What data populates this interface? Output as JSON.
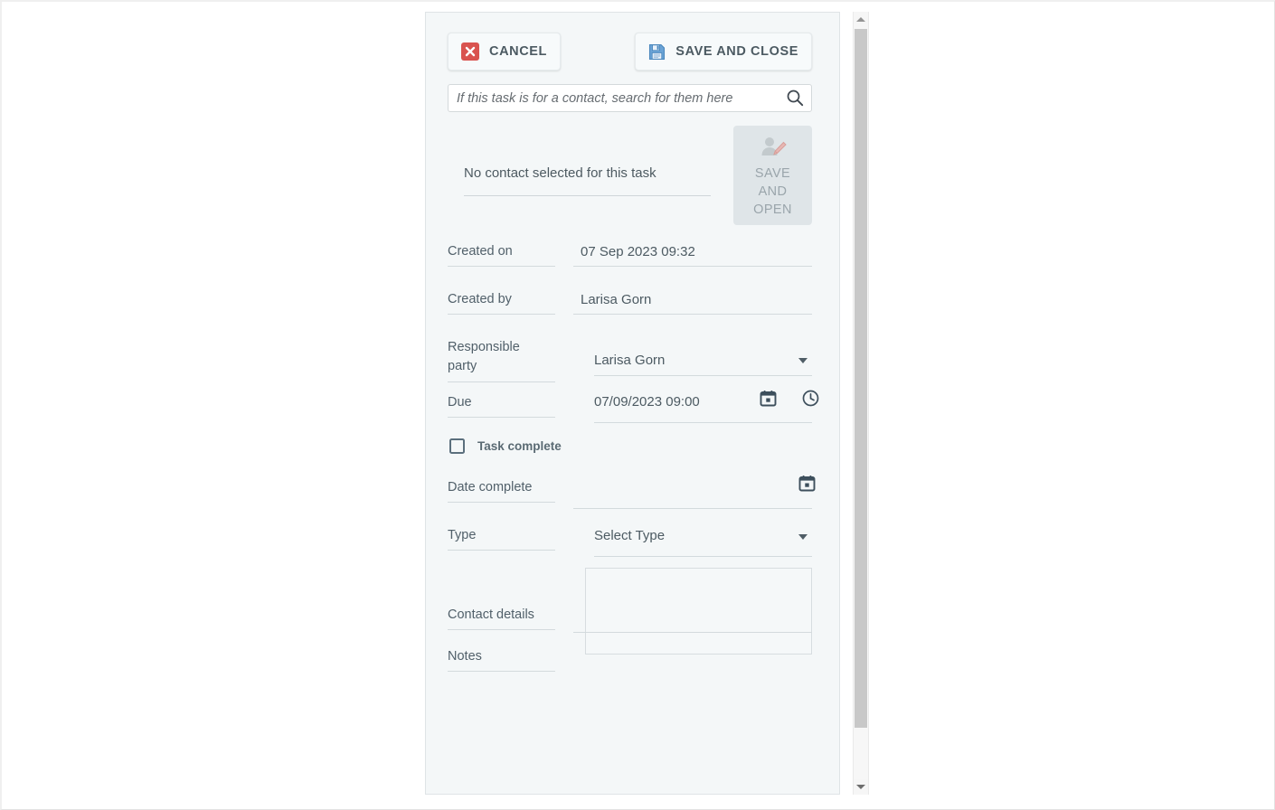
{
  "panel": {
    "toolbar": {
      "cancel_label": "CANCEL",
      "cancel_icon": "close-x-icon",
      "save_close_label": "SAVE AND CLOSE",
      "save_close_icon": "floppy-disk-save-icon"
    },
    "contact_search": {
      "value": "",
      "placeholder": "If this task is for a contact, search for them here",
      "icon": "search-icon"
    },
    "contact": {
      "status_text": "No contact selected for this task",
      "save_open_label_line1": "SAVE",
      "save_open_label_line2": "AND",
      "save_open_label_line3": "OPEN",
      "save_open_icon": "contact-edit-icon",
      "save_open_disabled": true
    },
    "fields": {
      "created_on_label": "Created on",
      "created_on_value": "07 Sep 2023 09:32",
      "created_by_label": "Created by",
      "created_by_value": "Larisa Gorn",
      "responsible_label": "Responsible party",
      "responsible_value": "Larisa Gorn",
      "responsible_arrow_icon": "chevron-down-icon",
      "due_label": "Due",
      "due_value": "07/09/2023 09:00",
      "due_calendar_icon": "calendar-icon",
      "due_clock_icon": "clock-icon",
      "task_complete_label": "Task complete",
      "task_complete_checked": false,
      "date_complete_label": "Date complete",
      "date_complete_value": "",
      "date_complete_calendar_icon": "calendar-icon",
      "type_label": "Type",
      "type_value": "Select Type",
      "type_arrow_icon": "chevron-down-icon",
      "contact_details_label": "Contact details",
      "contact_details_value": "",
      "notes_label": "Notes",
      "notes_value": ""
    },
    "scrollbar": {
      "up_icon": "triangle-up-icon",
      "down_icon": "triangle-down-icon"
    }
  },
  "colors": {
    "panel_bg": "#f4f7f8",
    "cancel_icon_red": "#d9534f",
    "save_icon_blue": "#5b9bd5",
    "label_text": "#51606a",
    "value_text": "#4c5a62",
    "disabled_bg": "#dfe5e8",
    "disabled_text": "#9aa5ab",
    "underline": "#d3dadd",
    "checkbox_border": "#5b6f7d"
  }
}
